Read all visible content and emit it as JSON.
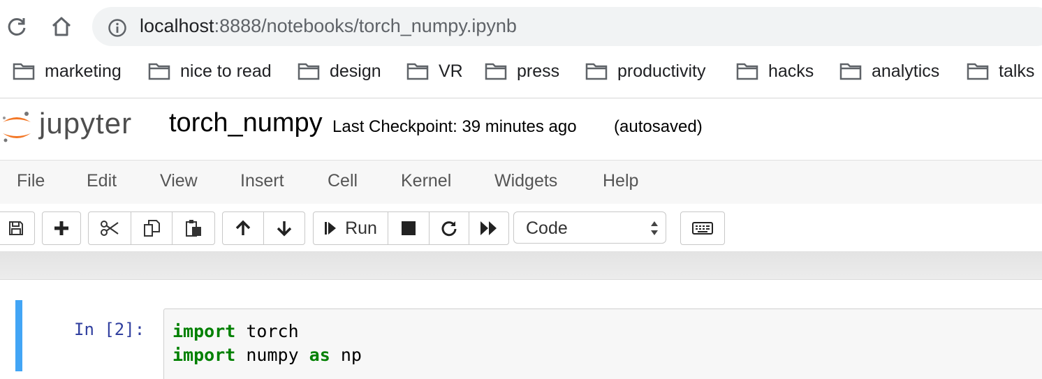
{
  "browser": {
    "url_host": "localhost",
    "url_rest": ":8888/notebooks/torch_numpy.ipynb",
    "bookmarks": [
      {
        "label": "marketing"
      },
      {
        "label": "nice to read"
      },
      {
        "label": "design"
      },
      {
        "label": "VR"
      },
      {
        "label": "press"
      },
      {
        "label": "productivity"
      },
      {
        "label": "hacks"
      },
      {
        "label": "analytics"
      },
      {
        "label": "talks"
      }
    ]
  },
  "jupyter": {
    "wordmark": "jupyter",
    "notebook_name": "torch_numpy",
    "checkpoint": "Last Checkpoint: 39 minutes ago",
    "autosaved": "(autosaved)",
    "logo_colors": {
      "orange": "#F37726",
      "gray": "#767677"
    }
  },
  "menu": [
    "File",
    "Edit",
    "View",
    "Insert",
    "Cell",
    "Kernel",
    "Widgets",
    "Help"
  ],
  "toolbar": {
    "run_label": "Run",
    "cell_type": "Code",
    "icons": [
      "save-icon",
      "plus-icon",
      "scissors-icon",
      "copy-icon",
      "paste-icon",
      "arrow-up-icon",
      "arrow-down-icon",
      "step-forward-icon",
      "stop-icon",
      "restart-icon",
      "fast-forward-icon",
      "keyboard-icon"
    ]
  },
  "cell": {
    "prompt": "In [2]:",
    "lines": [
      {
        "kw": "import",
        "rest": " torch",
        "kw2": "",
        "rest2": ""
      },
      {
        "kw": "import",
        "rest": " numpy ",
        "kw2": "as",
        "rest2": " np"
      }
    ],
    "accent": "#42A5F5"
  }
}
